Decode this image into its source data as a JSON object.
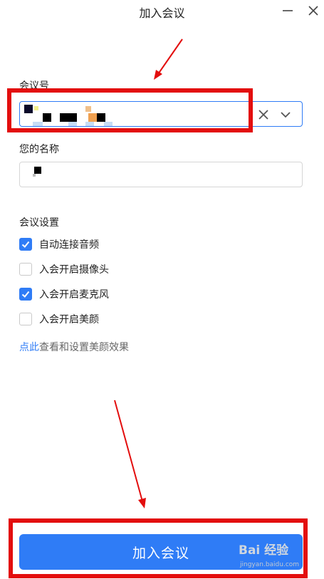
{
  "window": {
    "title": "加入会议"
  },
  "form": {
    "meeting_id_label": "会议号",
    "meeting_id_value": "",
    "name_label": "您的名称",
    "name_value": ""
  },
  "settings": {
    "heading": "会议设置",
    "options": [
      {
        "label": "自动连接音频",
        "checked": true
      },
      {
        "label": "入会开启摄像头",
        "checked": false
      },
      {
        "label": "入会开启麦克风",
        "checked": true
      },
      {
        "label": "入会开启美颜",
        "checked": false
      }
    ],
    "link_text": "点此",
    "link_suffix": "查看和设置美颜效果"
  },
  "join_button": {
    "label": "加入会议"
  },
  "watermark": {
    "logo": "Bai 经验",
    "domain": "jingyan.baidu.com"
  },
  "colors": {
    "accent": "#2f7cf6",
    "annotation": "#e30d0d"
  }
}
